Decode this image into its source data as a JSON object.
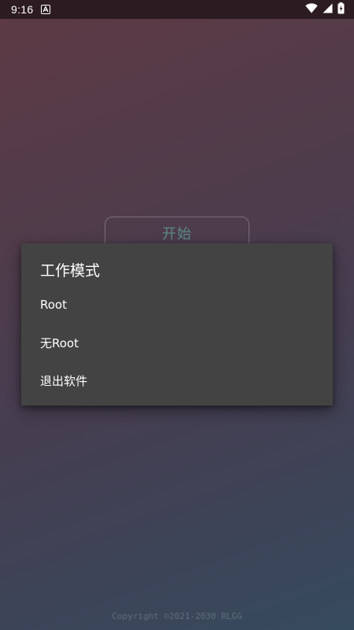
{
  "status_bar": {
    "time": "9:16",
    "icons": [
      "notification-a-icon",
      "wifi-icon",
      "signal-icon",
      "battery-charging-icon"
    ]
  },
  "main": {
    "start_label": "开始"
  },
  "dialog": {
    "title": "工作模式",
    "items": [
      {
        "label": "Root"
      },
      {
        "label": "无Root"
      },
      {
        "label": "退出软件"
      }
    ]
  },
  "footer": {
    "copyright": "Copyright ©2021-2030 RLGG"
  },
  "colors": {
    "dialog_bg": "#434343",
    "start_text": "#5b8a86",
    "status_bar_bg": "#2c1c22"
  }
}
